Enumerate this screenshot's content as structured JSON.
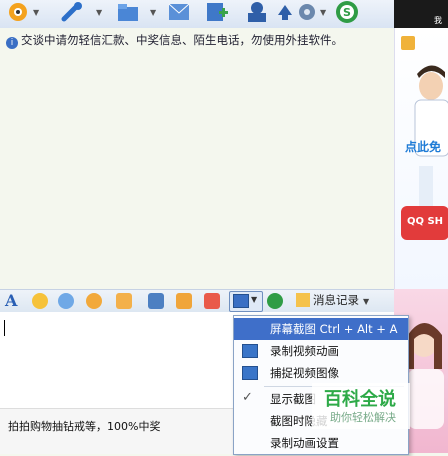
{
  "chat": {
    "notice": "交谈中请勿轻信汇款、中奖信息、陌生电话，勿使用外挂软件。"
  },
  "ads": {
    "top_text": "点此免",
    "qq_label": "QQ SH",
    "corner_text": "我"
  },
  "format_toolbar": {
    "history_label": "消息记录"
  },
  "status": {
    "text": "拍拍购物抽钻戒等，100%中奖"
  },
  "screenshot_menu": {
    "items": [
      {
        "label": "屏幕截图 Ctrl + Alt + A",
        "selected": true
      },
      {
        "label": "录制视频动画"
      },
      {
        "label": "捕捉视频图像"
      },
      {
        "label": "显示截图"
      },
      {
        "label": "截图时隐藏"
      },
      {
        "label": "录制动画设置"
      }
    ]
  },
  "watermark": {
    "title": "百科全说",
    "subtitle": "助你轻松解决"
  },
  "colors": {
    "menu_highlight": "#3f6fc9",
    "watermark_green": "#2eaa48"
  }
}
